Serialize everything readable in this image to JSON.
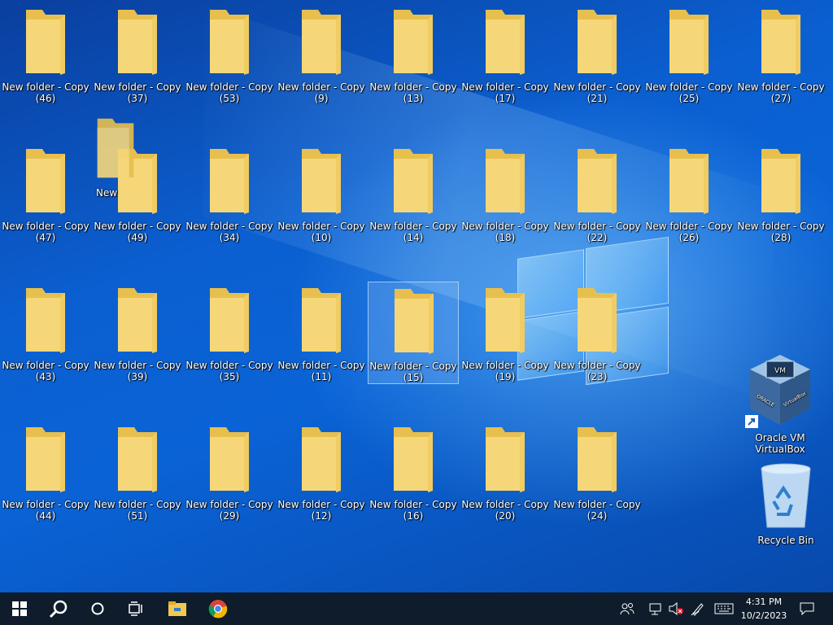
{
  "desktop": {
    "folders": [
      {
        "id": "46",
        "label": "New folder - Copy",
        "sub": "(46)"
      },
      {
        "id": "37",
        "label": "New folder - Copy",
        "sub": "(37)"
      },
      {
        "id": "53",
        "label": "New folder - Copy",
        "sub": "(53)"
      },
      {
        "id": "9",
        "label": "New folder - Copy",
        "sub": "(9)"
      },
      {
        "id": "13",
        "label": "New folder - Copy",
        "sub": "(13)"
      },
      {
        "id": "17",
        "label": "New folder - Copy",
        "sub": "(17)"
      },
      {
        "id": "21",
        "label": "New folder - Copy",
        "sub": "(21)"
      },
      {
        "id": "25",
        "label": "New folder - Copy",
        "sub": "(25)"
      },
      {
        "id": "27",
        "label": "New folder - Copy",
        "sub": "(27)"
      },
      {
        "id": "47",
        "label": "New folder - Copy",
        "sub": "(47)"
      },
      {
        "id": "49",
        "label": "New folder - Copy",
        "sub": "(49)"
      },
      {
        "id": "34",
        "label": "New folder - Copy",
        "sub": "(34)"
      },
      {
        "id": "10",
        "label": "New folder - Copy",
        "sub": "(10)"
      },
      {
        "id": "14",
        "label": "New folder - Copy",
        "sub": "(14)"
      },
      {
        "id": "18",
        "label": "New folder - Copy",
        "sub": "(18)"
      },
      {
        "id": "22",
        "label": "New folder - Copy",
        "sub": "(22)"
      },
      {
        "id": "26",
        "label": "New folder - Copy",
        "sub": "(26)"
      },
      {
        "id": "28",
        "label": "New folder - Copy",
        "sub": "(28)"
      },
      {
        "id": "43",
        "label": "New folder - Copy",
        "sub": "(43)"
      },
      {
        "id": "39",
        "label": "New folder - Copy",
        "sub": "(39)"
      },
      {
        "id": "35",
        "label": "New folder - Copy",
        "sub": "(35)"
      },
      {
        "id": "11",
        "label": "New folder - Copy",
        "sub": "(11)"
      },
      {
        "id": "15",
        "label": "New folder - Copy",
        "sub": "(15)",
        "selected": true
      },
      {
        "id": "19",
        "label": "New folder - Copy",
        "sub": "(19)"
      },
      {
        "id": "23",
        "label": "New folder - Copy",
        "sub": "(23)"
      },
      {
        "id": "44",
        "label": "New folder - Copy",
        "sub": "(44)"
      },
      {
        "id": "51",
        "label": "New folder - Copy",
        "sub": "(51)"
      },
      {
        "id": "29",
        "label": "New folder - Copy",
        "sub": "(29)"
      },
      {
        "id": "12",
        "label": "New folder - Copy",
        "sub": "(12)"
      },
      {
        "id": "16",
        "label": "New folder - Copy",
        "sub": "(16)"
      },
      {
        "id": "20",
        "label": "New folder - Copy",
        "sub": "(20)"
      },
      {
        "id": "24",
        "label": "New folder - Copy",
        "sub": "(24)"
      }
    ],
    "overlap_label": "New",
    "virtualbox": {
      "line1": "Oracle VM",
      "line2": "VirtualBox",
      "icon": "virtualbox-icon"
    },
    "recycle_bin": {
      "label": "Recycle Bin",
      "icon": "recycle-bin-icon"
    }
  },
  "taskbar": {
    "start_icon": "windows-start-icon",
    "search_icon": "search-icon",
    "cortana_icon": "cortana-icon",
    "taskview_icon": "task-view-icon",
    "explorer_icon": "file-explorer-icon",
    "chrome_icon": "chrome-icon",
    "tray": [
      "people-icon",
      "network-icon",
      "volume-muted-icon",
      "pen-icon",
      "keyboard-icon"
    ],
    "time": "4:31 PM",
    "date": "10/2/2023",
    "notification_icon": "notification-icon"
  },
  "colors": {
    "taskbar": "#0e1c2b",
    "folder": "#f5d77a",
    "folder_dark": "#e7bf4e",
    "accent": "#0b5fd0"
  }
}
